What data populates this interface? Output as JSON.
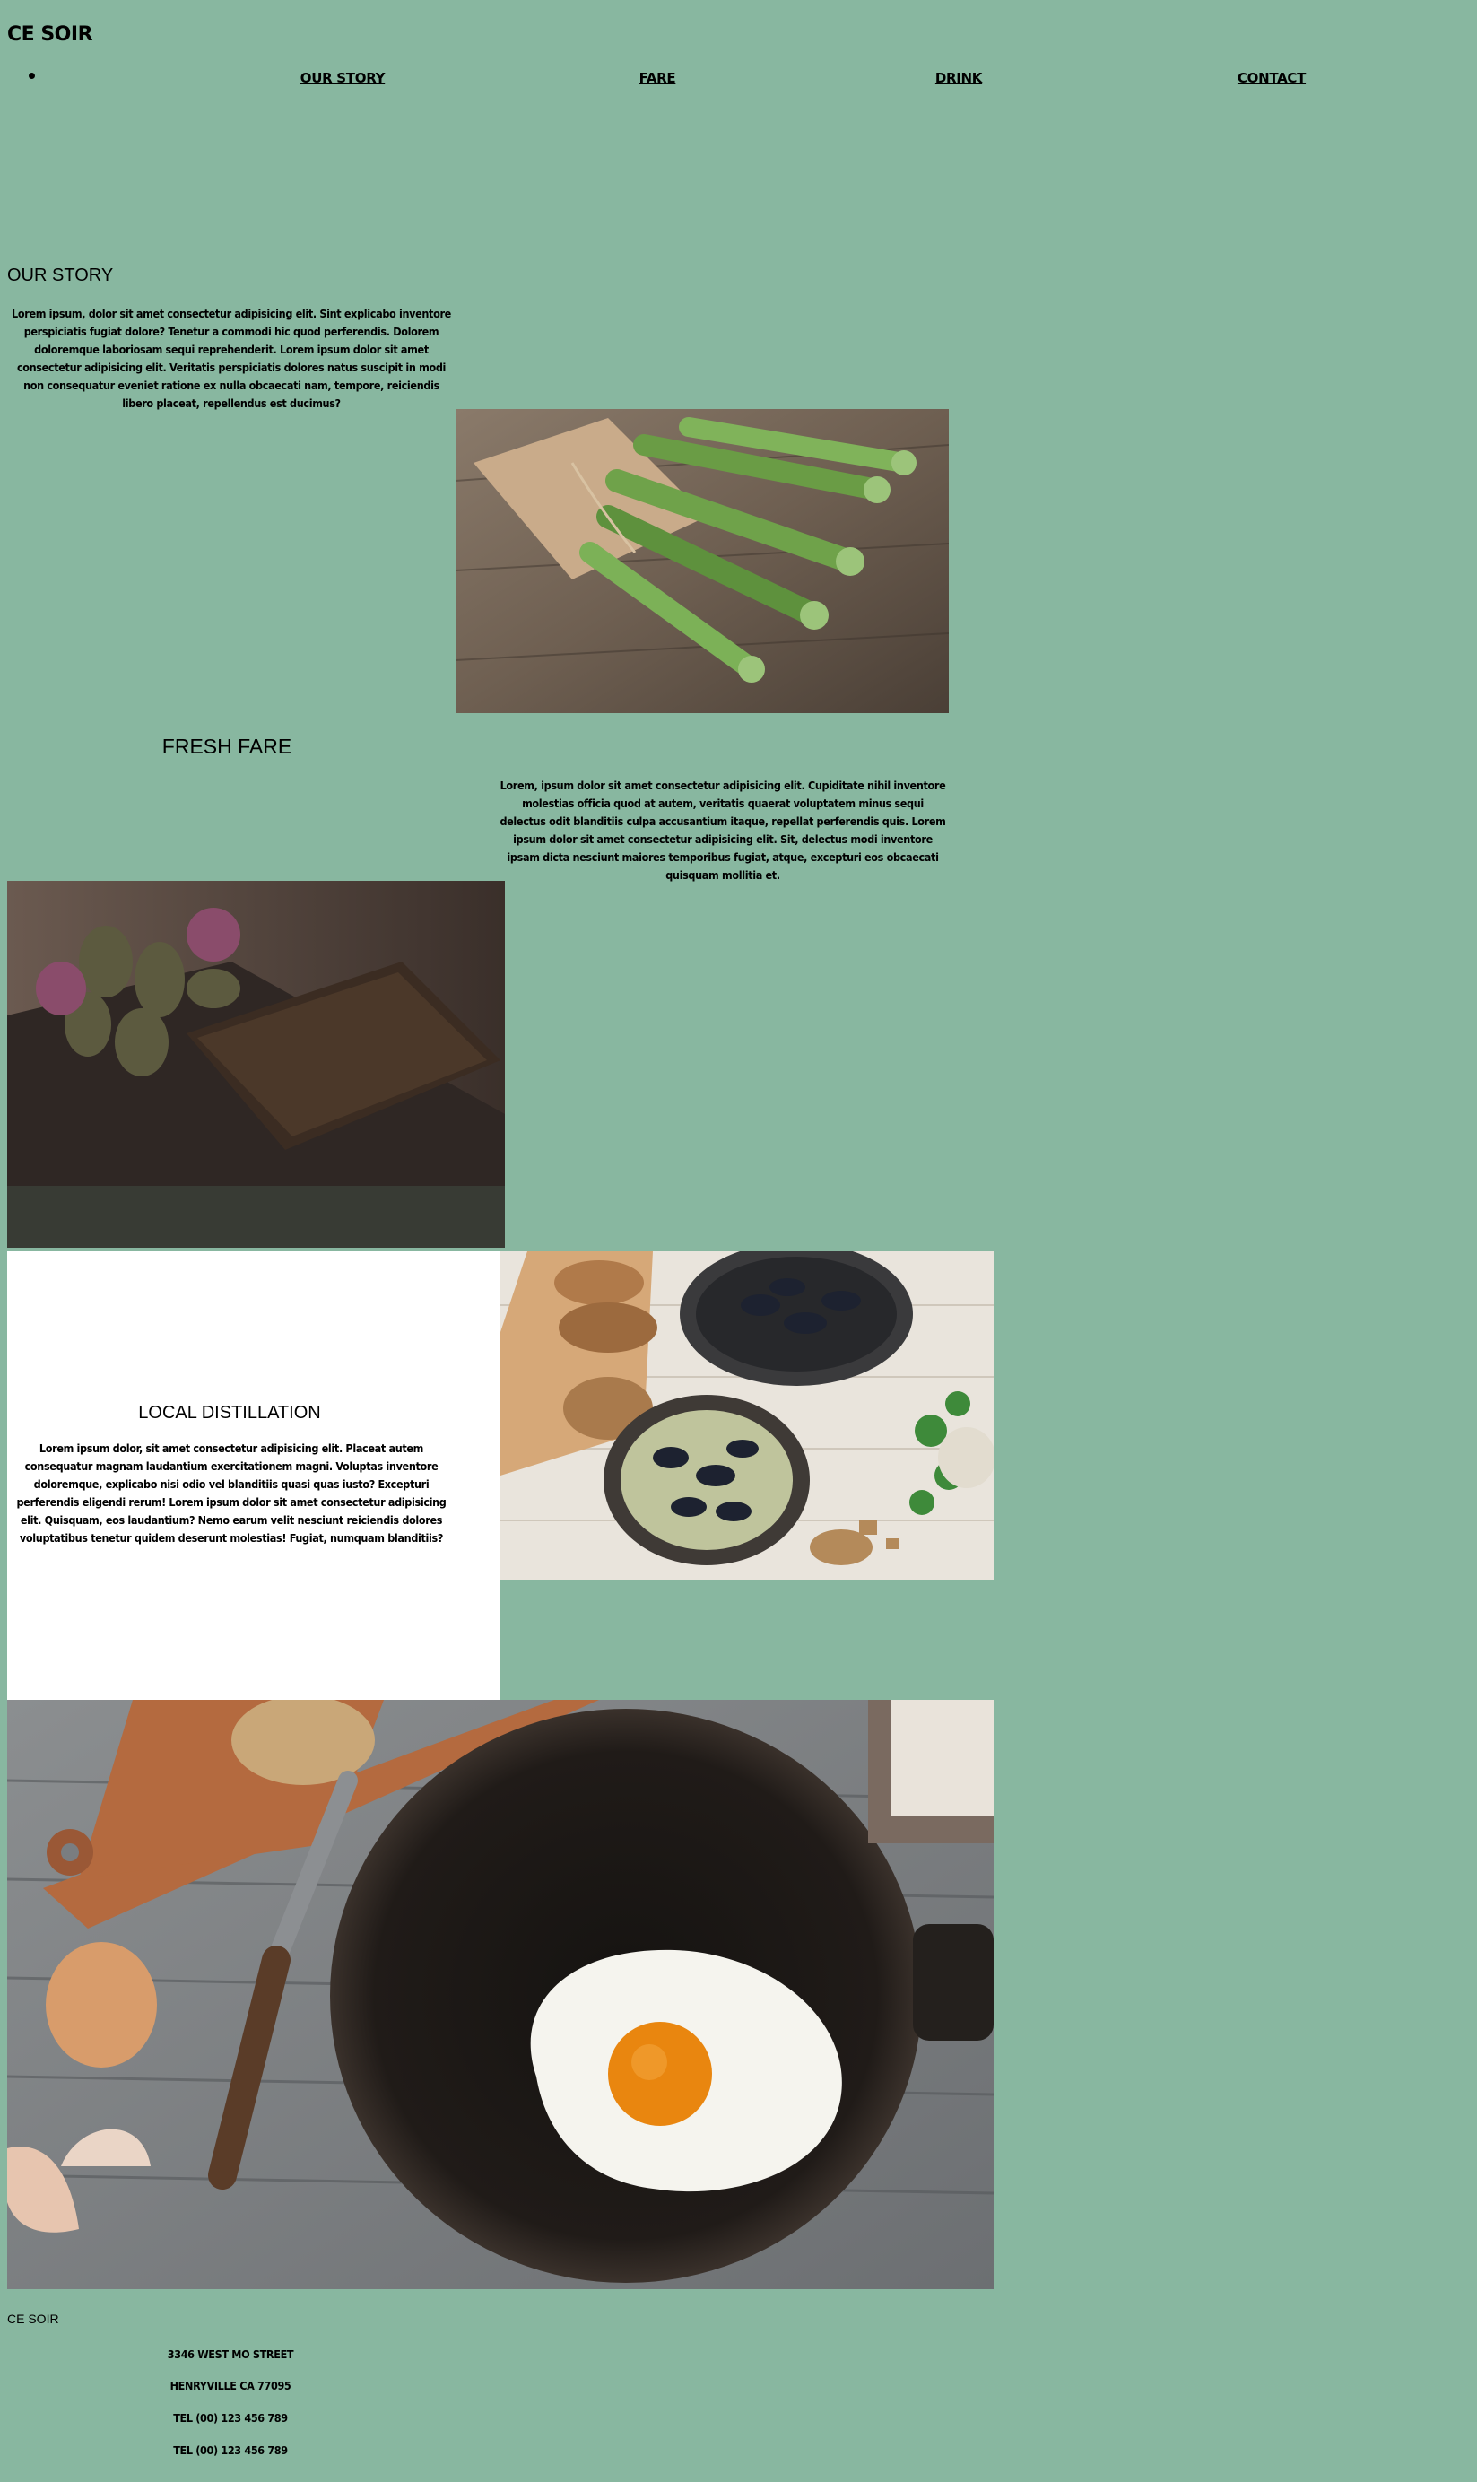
{
  "header": {
    "brand": "CE SOIR",
    "nav": [
      {
        "label": "OUR STORY"
      },
      {
        "label": "FARE"
      },
      {
        "label": "DRINK"
      },
      {
        "label": "CONTACT"
      }
    ]
  },
  "story": {
    "title": "OUR STORY",
    "body": "Lorem ipsum, dolor sit amet consectetur adipisicing elit. Sint explicabo inventore perspiciatis fugiat dolore? Tenetur a commodi hic quod perferendis. Dolorem doloremque laboriosam sequi reprehenderit. Lorem ipsum dolor sit amet consectetur adipisicing elit. Veritatis perspiciatis dolores natus suscipit in modi non consequatur eveniet ratione ex nulla obcaecati nam, tempore, reiciendis libero placeat, repellendus est ducimus?"
  },
  "fare": {
    "title": "FRESH FARE",
    "body": "Lorem, ipsum dolor sit amet consectetur adipisicing elit. Cupiditate nihil inventore molestias officia quod at autem, veritatis quaerat voluptatem minus sequi delectus odit blanditiis culpa accusantium itaque, repellat perferendis quis. Lorem ipsum dolor sit amet consectetur adipisicing elit. Sit, delectus modi inventore ipsam dicta nesciunt maiores temporibus fugiat, atque, excepturi eos obcaecati quisquam mollitia et."
  },
  "distillation": {
    "title": "LOCAL DISTILLATION",
    "body": "Lorem ipsum dolor, sit amet consectetur adipisicing elit. Placeat autem consequatur magnam laudantium exercitationem magni. Voluptas inventore doloremque, explicabo nisi odio vel blanditiis quasi quas iusto? Excepturi perferendis eligendi rerum! Lorem ipsum dolor sit amet consectetur adipisicing elit. Quisquam, eos laudantium? Nemo earum velit nesciunt reiciendis dolores voluptatibus tenetur quidem deserunt molestias! Fugiat, numquam blanditiis?"
  },
  "footer": {
    "brand": "CE SOIR",
    "lines": [
      "3346 WEST MO STREET",
      "HENRYVILLE CA 77095",
      "TEL (00) 123 456 789",
      "TEL (00) 123 456 789"
    ]
  }
}
